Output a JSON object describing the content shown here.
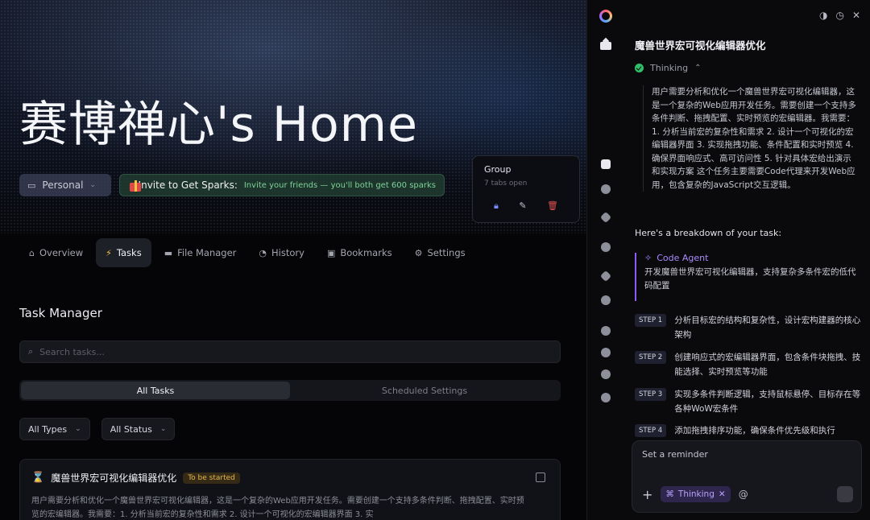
{
  "main": {
    "home_title": "赛博禅心's Home",
    "personal": {
      "label": "Personal"
    },
    "invite": {
      "title": "Invite to Get Sparks:",
      "subtitle": "Invite your friends — you'll both get 600 sparks"
    },
    "group_popup": {
      "title": "Group",
      "subtitle": "7 tabs open"
    },
    "tabs": [
      {
        "label": "Overview",
        "icon": "home-icon"
      },
      {
        "label": "Tasks",
        "icon": "lightning-icon"
      },
      {
        "label": "File Manager",
        "icon": "folder-icon"
      },
      {
        "label": "History",
        "icon": "clock-icon"
      },
      {
        "label": "Bookmarks",
        "icon": "bookmark-icon"
      },
      {
        "label": "Settings",
        "icon": "gear-icon"
      }
    ],
    "section_title": "Task Manager",
    "search_placeholder": "Search tasks...",
    "segments": [
      "All Tasks",
      "Scheduled Settings"
    ],
    "filters": [
      "All Types",
      "All Status"
    ],
    "task": {
      "title": "魔兽世界宏可视化编辑器优化",
      "status": "To be started",
      "description": "用户需要分析和优化一个魔兽世界宏可视化编辑器，这是一个复杂的Web应用开发任务。需要创建一个支持多条件判断、拖拽配置、实时预览的宏编辑器。我需要：1. 分析当前宏的复杂性和需求 2. 设计一个可视化的宏编辑器界面 3. 实"
    }
  },
  "chat": {
    "title": "魔兽世界宏可视化编辑器优化",
    "thinking_label": "Thinking",
    "thought": "用户需要分析和优化一个魔兽世界宏可视化编辑器，这是一个复杂的Web应用开发任务。需要创建一个支持多条件判断、拖拽配置、实时预览的宏编辑器。我需要：1. 分析当前宏的复杂性和需求 2. 设计一个可视化的宏编辑器界面 3. 实现拖拽功能、条件配置和实时预览 4. 确保界面响应式、高可访问性 5. 针对具体宏给出演示和实现方案 这个任务主要需要Code代理来开发Web应用，包含复杂的JavaScript交互逻辑。",
    "breakdown": "Here's a breakdown of your task:",
    "agent": {
      "name": "Code Agent",
      "desc": "开发魔兽世界宏可视化编辑器，支持复杂多条件宏的低代码配置"
    },
    "steps": [
      {
        "label": "STEP 1",
        "text": "分析目标宏的结构和复杂性，设计宏构建器的核心架构"
      },
      {
        "label": "STEP 2",
        "text": "创建响应式的宏编辑器界面，包含条件块拖拽、技能选择、实时预览等功能"
      },
      {
        "label": "STEP 3",
        "text": "实现多条件判断逻辑，支持鼠标悬停、目标存在等各种WoW宏条件"
      },
      {
        "label": "STEP 4",
        "text": "添加拖拽排序功能，确保条件优先级和执行"
      }
    ],
    "composer": {
      "placeholder": "Set a reminder",
      "chip": "Thinking",
      "at": "@"
    }
  }
}
